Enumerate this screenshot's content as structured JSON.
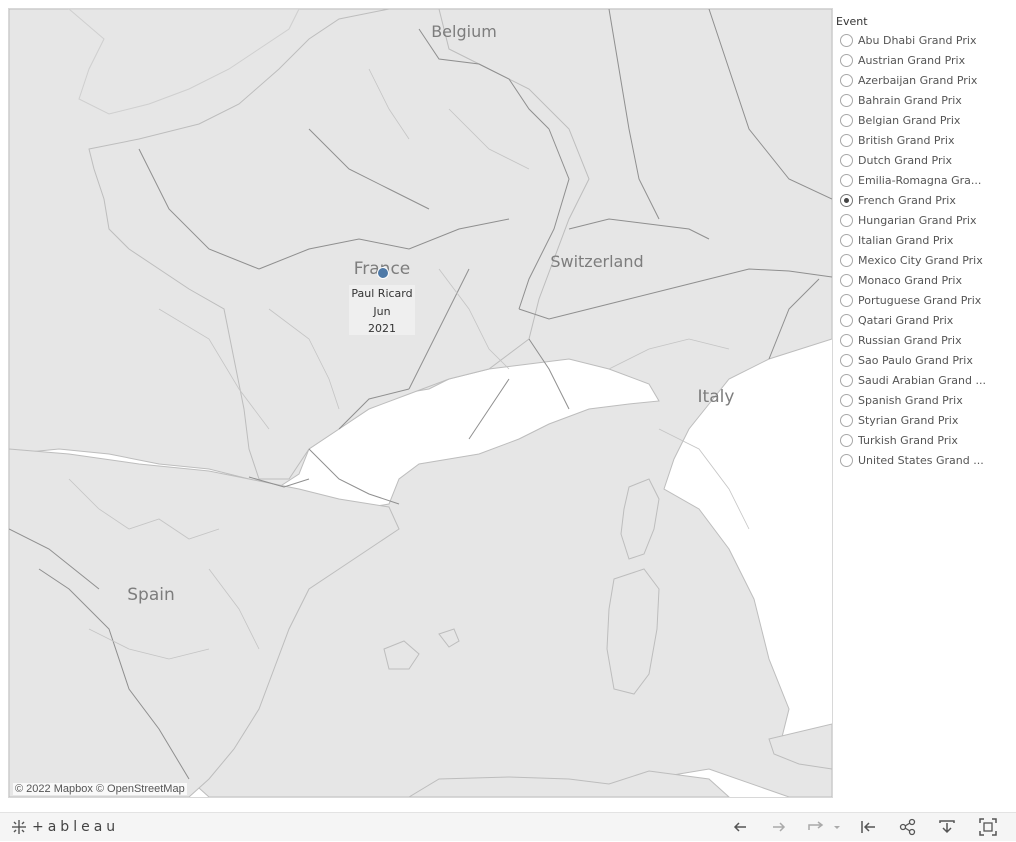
{
  "map": {
    "country_labels": {
      "belgium": "Belgium",
      "france": "France",
      "switzerland": "Switzerland",
      "italy": "Italy",
      "spain": "Spain"
    },
    "marker": {
      "circuit": "Paul Ricard",
      "month": "Jun",
      "year": "2021",
      "color": "#4e79a7"
    },
    "attribution": "© 2022 Mapbox  © OpenStreetMap",
    "colors": {
      "land": "#e6e6e6",
      "sea": "#ffffff",
      "border": "#8a8a8a"
    }
  },
  "filter": {
    "title": "Event",
    "selected": "French Grand Prix",
    "items": [
      "Abu Dhabi Grand Prix",
      "Austrian Grand Prix",
      "Azerbaijan Grand Prix",
      "Bahrain Grand Prix",
      "Belgian Grand Prix",
      "British Grand Prix",
      "Dutch Grand Prix",
      "Emilia-Romagna Gra...",
      "French Grand Prix",
      "Hungarian Grand Prix",
      "Italian Grand Prix",
      "Mexico City Grand Prix",
      "Monaco Grand Prix",
      "Portuguese Grand Prix",
      "Qatari Grand Prix",
      "Russian Grand Prix",
      "Sao Paulo Grand Prix",
      "Saudi Arabian Grand ...",
      "Spanish Grand Prix",
      "Styrian Grand Prix",
      "Turkish Grand Prix",
      "United States Grand ..."
    ]
  },
  "toolbar": {
    "logo": "+ableau",
    "icons": [
      "undo-icon",
      "redo-icon",
      "revert-icon",
      "reset-icon",
      "share-icon",
      "download-icon",
      "fullscreen-icon"
    ]
  }
}
